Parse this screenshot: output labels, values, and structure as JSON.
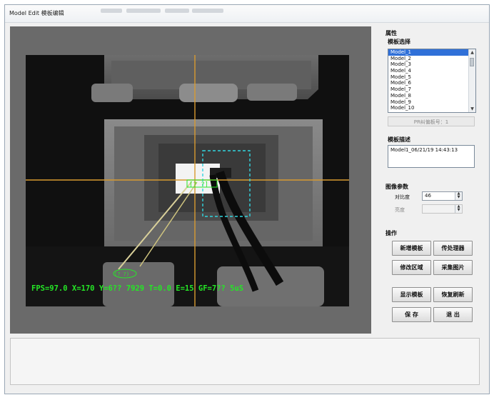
{
  "window": {
    "title": "Model Edit 模板编辑"
  },
  "camera": {
    "fps_readout": "FPS=97.0 X=170 Y=6?? 7929 T=0.0 E=15 GF=7?? 5uS",
    "roi_label": "[? ?]",
    "small_label": "(? ?)"
  },
  "panel": {
    "properties_header": "属性",
    "template_select_label": "模板选择",
    "models": [
      "Model_1",
      "Model_2",
      "Model_3",
      "Model_4",
      "Model_5",
      "Model_6",
      "Model_7",
      "Model_8",
      "Model_9",
      "Model_10"
    ],
    "selected_model_index": 0,
    "pr_button": "PR纠偏板号：1",
    "template_desc_label": "模板描述",
    "template_desc_value": "Model1_06/21/19 14:43:13",
    "image_params_label": "图像参数",
    "contrast_label": "对比度",
    "contrast_value": "46",
    "level_label": "亮度",
    "level_value": "",
    "operations_label": "操作",
    "buttons": {
      "new_template": "新增模板",
      "post_processor": "传处理器",
      "modify_region": "修改区域",
      "capture_image": "采集图片",
      "show_template": "显示模板",
      "restore_refresh": "恢复刷新",
      "save": "保 存",
      "exit": "退 出"
    }
  }
}
